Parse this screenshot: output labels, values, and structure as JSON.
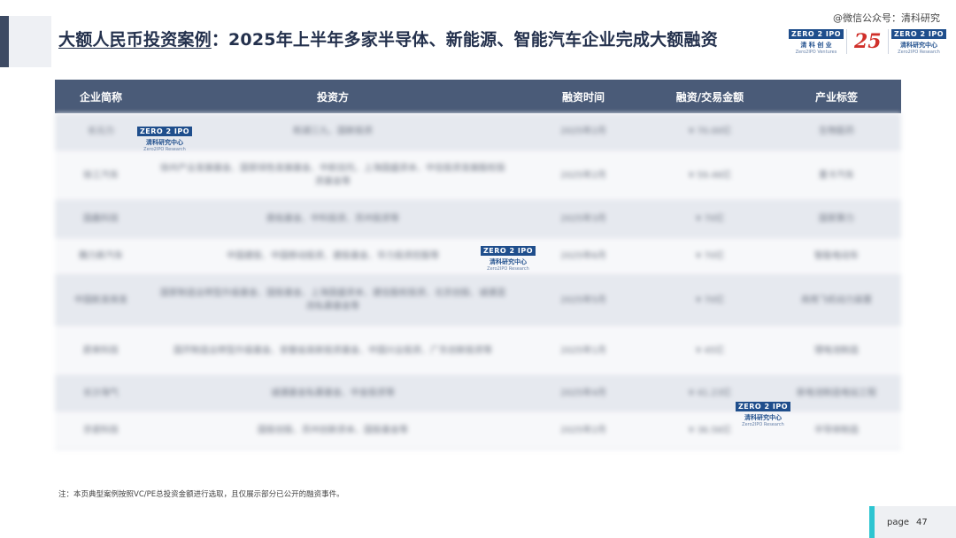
{
  "title": {
    "main": "大额人民币投资案例",
    "rest": "：2025年上半年多家半导体、新能源、智能汽车企业完成大额融资"
  },
  "watermark": "@微信公众号：清科研究",
  "logos": {
    "zero2ipo_top": "ZERO 2 IPO",
    "ventures_cn": "清 科 创 业",
    "ventures_en": "Zero2IPO Ventures",
    "badge": "25",
    "research_top": "ZERO 2 IPO",
    "research_cn": "清科研究中心",
    "research_en": "Zero2IPO Research"
  },
  "table": {
    "headers": [
      "企业简称",
      "投资方",
      "融资时间",
      "融资/交易金额",
      "产业标签"
    ],
    "rows": [
      {
        "company": "长元力",
        "investors": "和湖三九、国新投资",
        "date": "2025年2月",
        "amount": "¥ 70.00亿",
        "tag": "生物医药"
      },
      {
        "company": "徐工汽车",
        "investors": "徐州产业发展基金、国家绿色发展基金、中航信托、上海国盛资本、中信投资发展股权投资基金等",
        "date": "2025年2月",
        "amount": "¥ 59.46亿",
        "tag": "重卡汽车"
      },
      {
        "company": "国鑫科技",
        "investors": "鼎佑基金、中科投资、苏州投资等",
        "date": "2025年3月",
        "amount": "¥ 70亿",
        "tag": "国家算力"
      },
      {
        "company": "魏力新汽车",
        "investors": "中国建投、中国移动投资、建投基金、华力投资控股等",
        "date": "2025年6月",
        "amount": "¥ 70亿",
        "tag": "智能电动车"
      },
      {
        "company": "中国航发商发",
        "investors": "国家制造业转型升级基金、国投基金、上海国盛资本、建信股权投资、北京创投、诚通混改私募基金等",
        "date": "2025年5月",
        "amount": "¥ 70亿",
        "tag": "商用飞机动力装置"
      },
      {
        "company": "蔚来科技",
        "investors": "国开制造业转型升级基金、安徽省高新投资基金、中国兴业投资、广东创新投资等",
        "date": "2025年1月",
        "amount": "¥ 45亿",
        "tag": "锂电池制造"
      },
      {
        "company": "长沙海气",
        "investors": "诚通基金私募基金、中金投资等",
        "date": "2025年4月",
        "amount": "¥ 41.23亿",
        "tag": "新电池制造电站工程"
      },
      {
        "company": "京瓷科技",
        "investors": "国投创投、苏州创新资本、国投基金等",
        "date": "2025年2月",
        "amount": "¥ 36.56亿",
        "tag": "半导体制造"
      }
    ]
  },
  "note": "注：本页典型案例按照VC/PE总投资金额进行选取，且仅展示部分已公开的融资事件。",
  "page": {
    "label": "page",
    "number": "47"
  }
}
